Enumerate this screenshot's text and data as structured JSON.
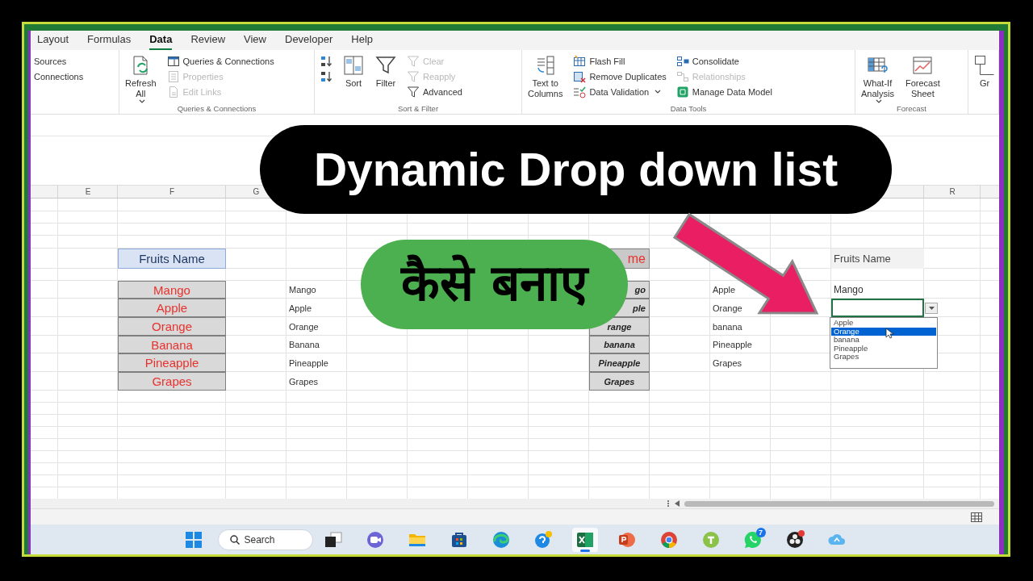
{
  "ribbon_tabs": [
    {
      "label": "Layout",
      "selected": false
    },
    {
      "label": "Formulas",
      "selected": false
    },
    {
      "label": "Data",
      "selected": true
    },
    {
      "label": "Review",
      "selected": false
    },
    {
      "label": "View",
      "selected": false
    },
    {
      "label": "Developer",
      "selected": false
    },
    {
      "label": "Help",
      "selected": false
    }
  ],
  "ribbon_groups": [
    {
      "columns": [
        {
          "kind": "stack",
          "items": [
            {
              "label": "Sources",
              "disabled": false
            },
            {
              "label": "Connections",
              "disabled": false
            }
          ]
        }
      ]
    },
    {
      "label": "Queries & Connections",
      "columns": [
        {
          "kind": "large",
          "lines": [
            "Refresh",
            "All"
          ],
          "menu": true
        },
        {
          "kind": "stack",
          "items": [
            {
              "label": "Queries & Connections",
              "disabled": false
            },
            {
              "label": "Properties",
              "disabled": true
            },
            {
              "label": "Edit Links",
              "disabled": true
            }
          ]
        }
      ]
    },
    {
      "label": "Sort & Filter",
      "columns": [
        {
          "kind": "stack",
          "items": [
            {
              "disabled": false
            },
            {
              "disabled": false
            }
          ]
        },
        {
          "kind": "large",
          "lines": [
            "Sort"
          ],
          "menu": false
        },
        {
          "kind": "large",
          "lines": [
            "Filter"
          ],
          "menu": false
        },
        {
          "kind": "stack",
          "items": [
            {
              "label": "Clear",
              "disabled": true
            },
            {
              "label": "Reapply",
              "disabled": true
            },
            {
              "label": "Advanced",
              "disabled": false
            }
          ]
        }
      ]
    },
    {
      "label": "Data Tools",
      "columns": [
        {
          "kind": "large",
          "lines": [
            "Text to",
            "Columns"
          ],
          "menu": false
        },
        {
          "kind": "stack",
          "items": [
            {
              "label": "Flash Fill",
              "disabled": false
            },
            {
              "label": "Remove Duplicates",
              "disabled": false
            },
            {
              "label": "Data Validation",
              "disabled": false,
              "menu": true
            }
          ]
        },
        {
          "kind": "stack",
          "items": [
            {
              "label": "Consolidate",
              "disabled": false
            },
            {
              "label": "Relationships",
              "disabled": true
            },
            {
              "label": "Manage Data Model",
              "disabled": false
            }
          ]
        }
      ]
    },
    {
      "label": "Forecast",
      "columns": [
        {
          "kind": "large",
          "lines": [
            "What-If",
            "Analysis"
          ],
          "menu": true
        },
        {
          "kind": "large",
          "lines": [
            "Forecast",
            "Sheet"
          ],
          "menu": false
        }
      ]
    },
    {
      "columns": [
        {
          "kind": "large",
          "lines": [
            "Gr"
          ],
          "menu": false
        }
      ]
    }
  ],
  "sheet": {
    "column_headers": [
      "E",
      "F",
      "G",
      "R"
    ],
    "fruits_table": {
      "header": "Fruits Name",
      "items": [
        "Mango",
        "Apple",
        "Orange",
        "Banana",
        "Pineapple",
        "Grapes"
      ]
    },
    "fruit_list": [
      "Mango",
      "Apple",
      "Orange",
      "Banana",
      "Pineapple",
      "Grapes"
    ],
    "styled_table": {
      "header": "me",
      "items": [
        "go",
        "ple",
        "range",
        "banana",
        "Pineapple",
        "Grapes"
      ]
    },
    "source_list": [
      "Apple",
      "Orange",
      "banana",
      "Pineapple",
      "Grapes"
    ],
    "dropdown_demo": {
      "header": "Fruits Name",
      "value": "Mango",
      "options": [
        {
          "label": "Apple",
          "selected": false
        },
        {
          "label": "Orange",
          "selected": true
        },
        {
          "label": "banana",
          "selected": false
        },
        {
          "label": "Pineapple",
          "selected": false
        },
        {
          "label": "Grapes",
          "selected": false
        }
      ]
    }
  },
  "overlay": {
    "title": "Dynamic Drop down list",
    "subtitle": "कैसे बनाए"
  },
  "taskbar": {
    "search": "Search",
    "apps": [
      {
        "active": false
      },
      {
        "active": false
      },
      {
        "active": false
      },
      {
        "active": false
      },
      {
        "active": false
      },
      {
        "active": false
      },
      {
        "active": true
      },
      {
        "active": false
      },
      {
        "active": false
      },
      {
        "active": false
      },
      {
        "active": false,
        "badge": "7"
      },
      {
        "active": false
      },
      {
        "active": false
      }
    ]
  }
}
